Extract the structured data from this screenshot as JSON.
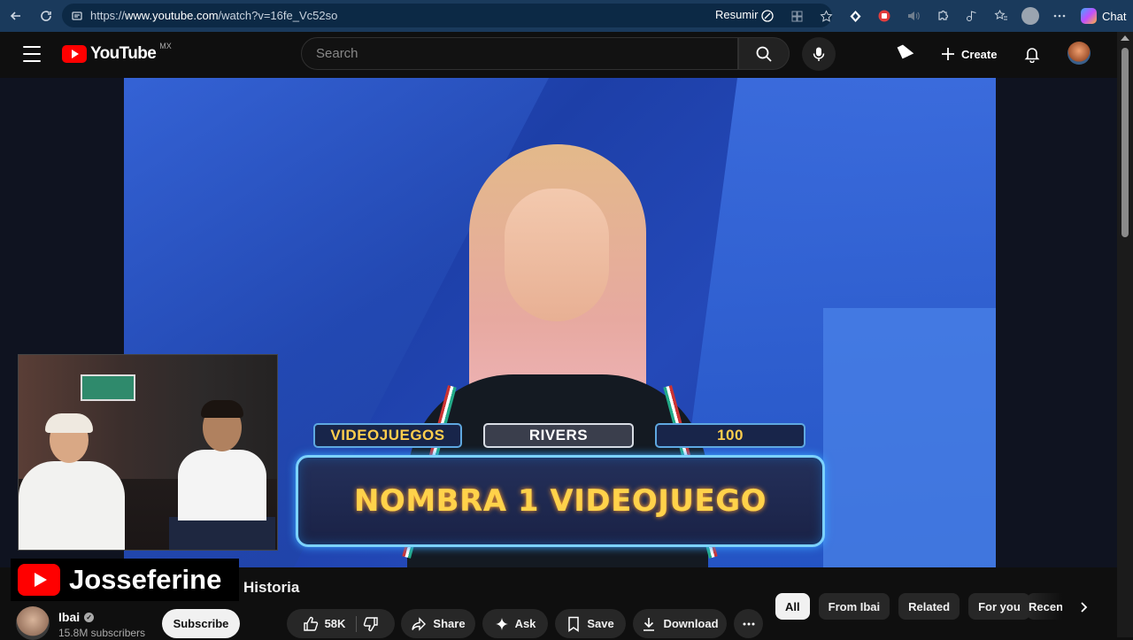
{
  "browser": {
    "url_prefix": "https://",
    "url_domain": "www.youtube.com",
    "url_path": "/watch?v=16fe_Vc52so",
    "resumir_label": "Resumir",
    "chat_label": "Chat"
  },
  "header": {
    "logo_text": "YouTube",
    "country_code": "MX",
    "search_placeholder": "Search",
    "create_label": "Create"
  },
  "video": {
    "tag_category": "VIDEOJUEGOS",
    "tag_name": "RIVERS",
    "tag_points": "100",
    "question": "NOMBRA 1 VIDEOJUEGO",
    "overlay_channel": "Josseferine"
  },
  "meta": {
    "title_fragment": "Historia",
    "channel_name": "Ibai",
    "subscribers": "15.8M subscribers",
    "subscribe_label": "Subscribe",
    "likes": "58K",
    "share_label": "Share",
    "ask_label": "Ask",
    "save_label": "Save",
    "download_label": "Download"
  },
  "chips": [
    "All",
    "From Ibai",
    "Related",
    "For you"
  ],
  "chip_partial": "Recen",
  "colors": {
    "browser_bar": "#1a3a5c",
    "youtube_red": "#ff0000",
    "question_text": "#ffd24a",
    "question_border": "#7cd2ff"
  }
}
